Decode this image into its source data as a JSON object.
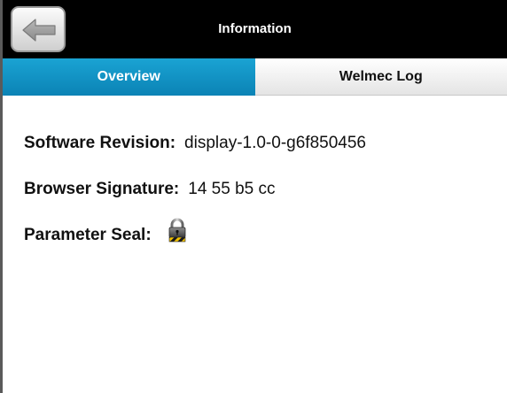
{
  "header": {
    "title": "Information",
    "back_icon": "back-arrow-icon"
  },
  "tabs": [
    {
      "label": "Overview",
      "active": true
    },
    {
      "label": "Welmec Log",
      "active": false
    }
  ],
  "info": {
    "software_revision_label": "Software Revision:",
    "software_revision_value": "display-1.0-0-g6f850456",
    "browser_signature_label": "Browser Signature:",
    "browser_signature_value": "14 55 b5 cc",
    "parameter_seal_label": "Parameter Seal:",
    "parameter_seal_icon": "padlock-icon",
    "parameter_seal_state": "locked"
  },
  "colors": {
    "header_bg": "#000000",
    "tab_active": "#0f93c4",
    "tab_inactive": "#f0f0f0",
    "text": "#111111"
  }
}
